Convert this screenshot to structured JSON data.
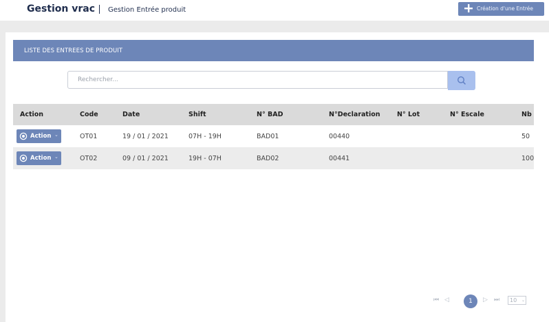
{
  "header": {
    "app_title": "Gestion vrac",
    "page_subtitle": "Gestion Entrée produit",
    "create_button_label": "Création d'une Entrée",
    "create_button_icon": "plus-icon"
  },
  "panel": {
    "title": "LISTE DES ENTREES DE PRODUIT",
    "search": {
      "placeholder": "Rechercher...",
      "value": "",
      "button_icon": "search-icon"
    }
  },
  "table": {
    "columns": [
      "Action",
      "Code",
      "Date",
      "Shift",
      "N° BAD",
      "N°Declaration",
      "N° Lot",
      "N° Escale",
      "Nb"
    ],
    "rows": [
      {
        "action_label": "Action",
        "code": "OT01",
        "date": "19 / 01 / 2021",
        "shift": "07H - 19H",
        "bad": "BAD01",
        "declaration": "00440",
        "lot": "",
        "escale": "",
        "nb": "50"
      },
      {
        "action_label": "Action",
        "code": "OT02",
        "date": "09 / 01 / 2021",
        "shift": "19H - 07H",
        "bad": "BAD02",
        "declaration": "00441",
        "lot": "",
        "escale": "",
        "nb": "100"
      }
    ]
  },
  "pagination": {
    "current_page": "1",
    "page_size": "10",
    "first_icon": "⏮",
    "prev_icon": "◁",
    "next_icon": "▷",
    "last_icon": "⏭"
  },
  "colors": {
    "accent": "#6d86b8",
    "search_button": "#a9c0ee",
    "header_bg": "#dadada"
  }
}
